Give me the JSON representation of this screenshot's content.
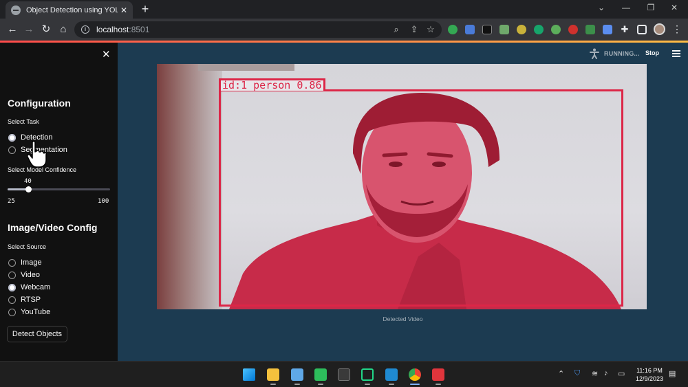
{
  "browser": {
    "tab_title": "Object Detection using YOLOv8",
    "url_host": "localhost",
    "url_port": ":8501"
  },
  "sidebar": {
    "config_heading": "Configuration",
    "task_label": "Select Task",
    "tasks": [
      {
        "label": "Detection",
        "checked": true
      },
      {
        "label": "Segmentation",
        "checked": false
      }
    ],
    "confidence_label": "Select Model Confidence",
    "confidence": {
      "value": "40",
      "min": "25",
      "max": "100",
      "fraction": 0.2
    },
    "media_heading": "Image/Video Config",
    "source_label": "Select Source",
    "sources": [
      {
        "label": "Image",
        "checked": false
      },
      {
        "label": "Video",
        "checked": false
      },
      {
        "label": "Webcam",
        "checked": true
      },
      {
        "label": "RTSP",
        "checked": false
      },
      {
        "label": "YouTube",
        "checked": false
      }
    ],
    "detect_button": "Detect Objects"
  },
  "main": {
    "status": "RUNNING...",
    "stop": "Stop",
    "detection_label": "id:1 person 0.86",
    "caption": "Detected Video"
  },
  "taskbar": {
    "time": "11:16 PM",
    "date": "12/9/2023"
  },
  "colors": {
    "accent": "#ff4b4b",
    "bbox": "#dc2647",
    "main_bg": "#1c3b51",
    "sidebar_bg": "#111111"
  }
}
